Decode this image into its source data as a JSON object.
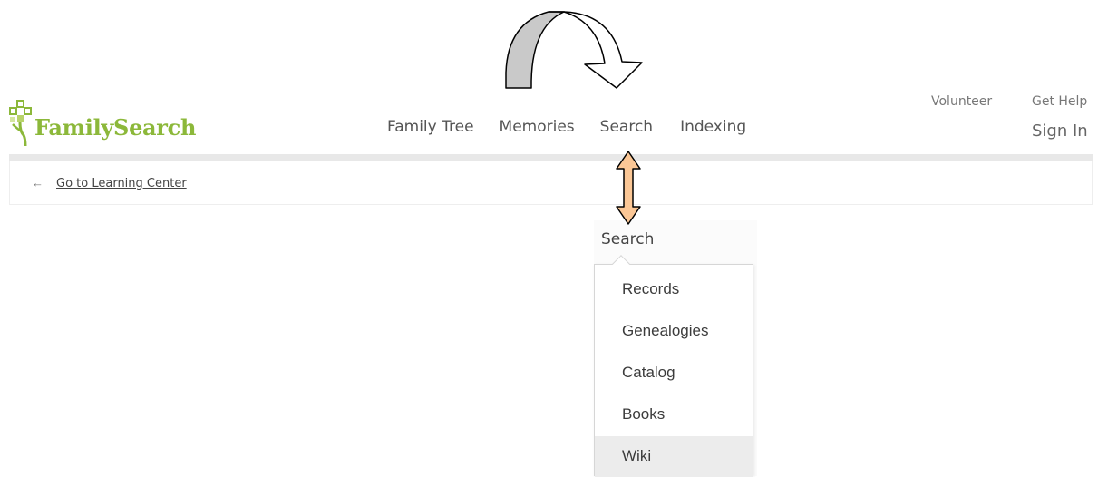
{
  "header": {
    "logo_text": "FamilySearch",
    "nav": [
      {
        "label": "Family Tree"
      },
      {
        "label": "Memories"
      },
      {
        "label": "Search"
      },
      {
        "label": "Indexing"
      }
    ],
    "utility": {
      "volunteer": "Volunteer",
      "get_help": "Get Help",
      "sign_in": "Sign In"
    }
  },
  "breadcrumb": {
    "arrow": "←",
    "link_label": "Go to Learning Center"
  },
  "dropdown": {
    "label": "Search",
    "items": [
      {
        "label": "Records"
      },
      {
        "label": "Genealogies"
      },
      {
        "label": "Catalog"
      },
      {
        "label": "Books"
      },
      {
        "label": "Wiki",
        "highlighted": true
      }
    ]
  },
  "colors": {
    "brand_green": "#8cb83a",
    "annotation_arrow_fill": "#fbc796",
    "curved_arrow_fill": "#c9c9c9",
    "hover_row": "#ececec"
  },
  "icons": {
    "curved_arrow": "curved-arrow-icon",
    "double_arrow": "double-arrow-icon",
    "logo": "family-tree-logo-icon"
  }
}
